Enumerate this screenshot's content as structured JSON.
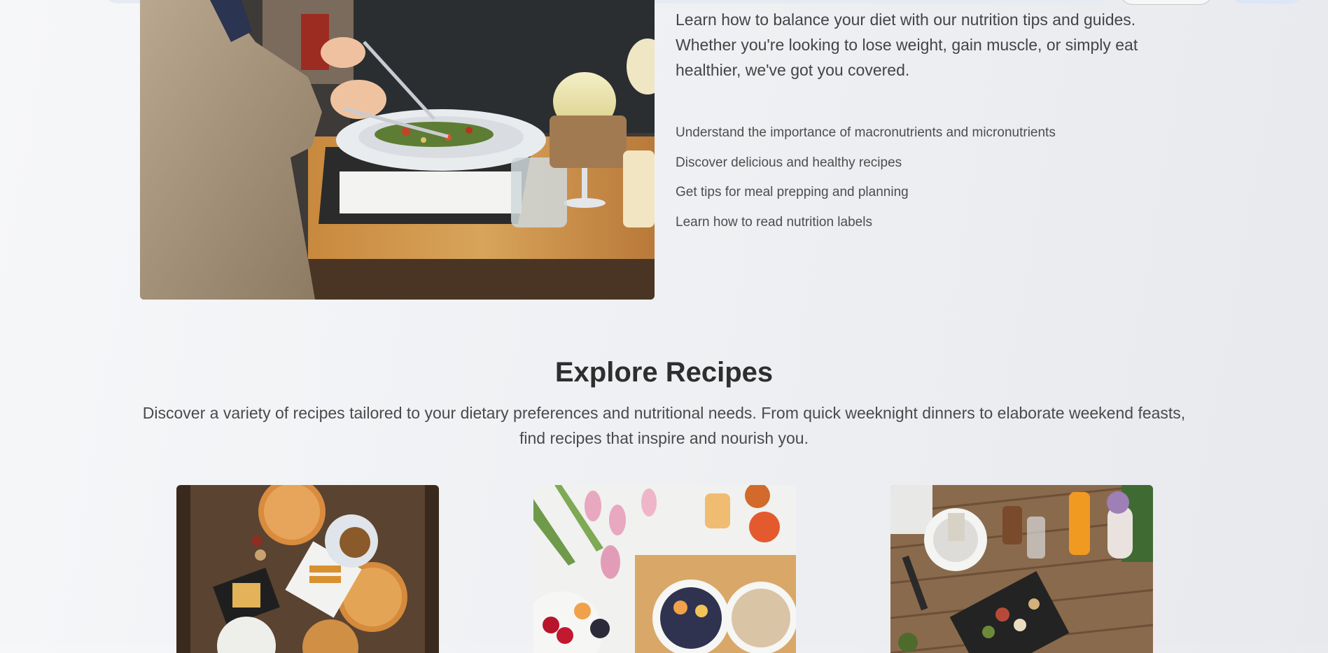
{
  "nutrition_section": {
    "intro": "Learn how to balance your diet with our nutrition tips and guides. Whether you're looking to lose weight, gain muscle, or simply eat healthier, we've got you covered.",
    "tips": [
      "Understand the importance of macronutrients and micronutrients",
      "Discover delicious and healthy recipes",
      "Get tips for meal prepping and planning",
      "Learn how to read nutrition labels"
    ]
  },
  "recipes_section": {
    "title": "Explore Recipes",
    "description": "Discover a variety of recipes tailored to your dietary preferences and nutritional needs. From quick weeknight dinners to elaborate weekend feasts, find recipes that inspire and nourish you.",
    "cards": [
      {
        "image": "pizza-feast-photo"
      },
      {
        "image": "breakfast-bowls-photo"
      },
      {
        "image": "outdoor-table-photo"
      }
    ]
  }
}
